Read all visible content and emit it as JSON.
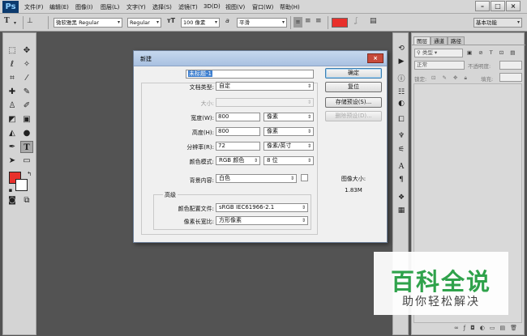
{
  "app": {
    "logo": "Ps",
    "menu": [
      "文件(F)",
      "编辑(E)",
      "图像(I)",
      "图层(L)",
      "文字(Y)",
      "选择(S)",
      "滤镜(T)",
      "3D(D)",
      "视图(V)",
      "窗口(W)",
      "帮助(H)"
    ],
    "window_controls": [
      "–",
      "□",
      "×"
    ]
  },
  "options_bar": {
    "font_family": "微软雅黑 Regular",
    "font_style": "Regular",
    "font_size": "100 像素",
    "antialias_label": "a",
    "antialias": "平滑",
    "text_color": "#e8302b",
    "workspace": "基本功能"
  },
  "layers_panel": {
    "tabs": [
      "图层",
      "通道",
      "路径"
    ],
    "filter_kind": "类型",
    "blend_mode": "正常",
    "opacity_label": "不透明度:",
    "lock_label": "锁定:",
    "fill_label": "填充:"
  },
  "dialog": {
    "title": "新建",
    "close_glyph": "×",
    "name_label": "名称(N):",
    "name_value": "未标题-1",
    "preset_label": "文档类型:",
    "preset_value": "自定",
    "size_label": "大小:",
    "width_label": "宽度(W):",
    "width_value": "800",
    "width_unit": "像素",
    "height_label": "高度(H):",
    "height_value": "800",
    "height_unit": "像素",
    "resolution_label": "分辨率(R):",
    "resolution_value": "72",
    "resolution_unit": "像素/英寸",
    "color_mode_label": "颜色模式:",
    "color_mode_value": "RGB 颜色",
    "bit_depth": "8 位",
    "background_label": "背景内容:",
    "background_value": "白色",
    "advanced_label": "高级",
    "profile_label": "颜色配置文件:",
    "profile_value": "sRGB IEC61966-2.1",
    "aspect_label": "像素长宽比:",
    "aspect_value": "方形像素",
    "image_size_label": "图像大小:",
    "image_size_value": "1.83M",
    "buttons": {
      "ok": "确定",
      "reset": "复位",
      "save_preset": "存储预设(S)...",
      "delete_preset": "删除预设(D)..."
    }
  },
  "watermark": {
    "title": "百科全说",
    "subtitle": "助你轻松解决"
  },
  "colors": {
    "foreground": "#e8302b",
    "background": "#ffffff",
    "workspace_bg": "#535353",
    "selection": "#3c7ecf",
    "brand_green": "#2fa24b"
  }
}
